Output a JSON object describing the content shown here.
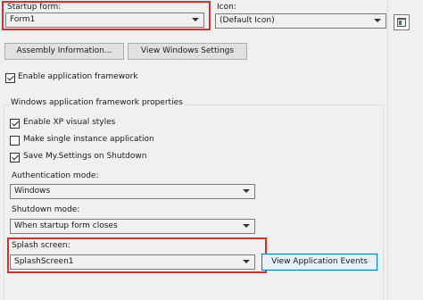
{
  "startup_form": {
    "label": "Startup form:",
    "value": "Form1"
  },
  "icon": {
    "label": "Icon:",
    "value": "(Default Icon)",
    "preview_icon": "window-icon"
  },
  "buttons": {
    "assembly_information": "Assembly Information...",
    "view_windows_settings": "View Windows Settings",
    "view_application_events": "View Application Events"
  },
  "enable_framework": {
    "label": "Enable application framework",
    "checked": true
  },
  "framework_group": {
    "title": "Windows application framework properties",
    "options": [
      {
        "label": "Enable XP visual styles",
        "checked": true
      },
      {
        "label": "Make single instance application",
        "checked": false
      },
      {
        "label": "Save My.Settings on Shutdown",
        "checked": true
      }
    ],
    "authentication_mode": {
      "label": "Authentication mode:",
      "value": "Windows"
    },
    "shutdown_mode": {
      "label": "Shutdown mode:",
      "value": "When startup form closes"
    },
    "splash_screen": {
      "label": "Splash screen:",
      "value": "SplashScreen1"
    }
  },
  "highlight_color": "#d9302b"
}
